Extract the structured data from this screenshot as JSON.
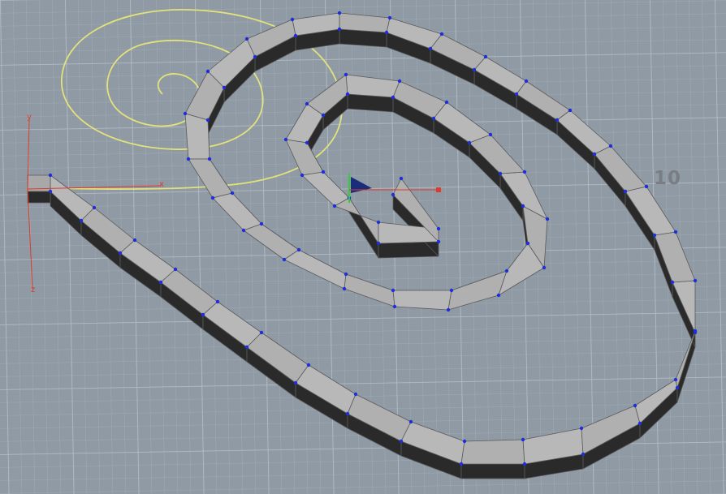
{
  "viewport": {
    "grid_label": "10",
    "axes": {
      "x": "x",
      "y": "y",
      "z": "z"
    }
  },
  "colors": {
    "background": "#8f9aa4",
    "grid_minor": "#a0abb4",
    "grid_major": "#b4bec6",
    "curve": "#e3e27a",
    "face_top": "#b8b8b8",
    "face_side": "#2a2a2a",
    "edge": "#5a5a5a",
    "point": "#1f2fd8",
    "axis": "#e03a2a",
    "handle_green": "#2fd03a",
    "handle_blue": "#1a2d7a"
  },
  "icons": [
    "origin-axes-icon",
    "transform-handle-icon"
  ]
}
